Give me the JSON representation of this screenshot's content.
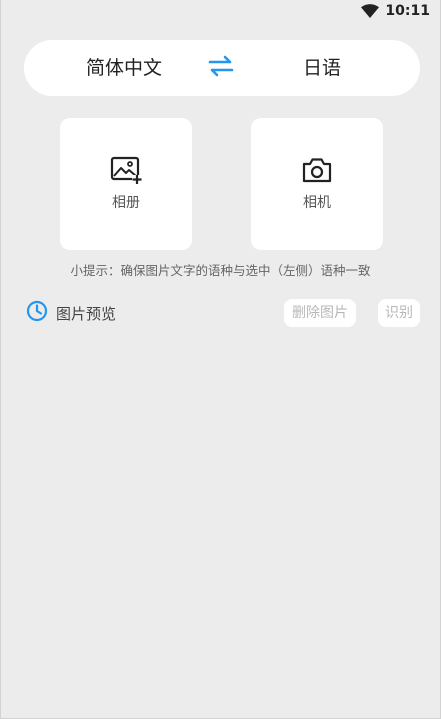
{
  "status_bar": {
    "time": "10:11",
    "wifi_icon": "wifi-icon"
  },
  "language_bar": {
    "source": "简体中文",
    "target": "日语",
    "swap_icon": "swap-icon",
    "accent": "#2196f3"
  },
  "cards": {
    "album_label": "相册",
    "album_icon": "image-add-icon",
    "camera_label": "相机",
    "camera_icon": "camera-icon"
  },
  "tip": "小提示：确保图片文字的语种与选中（左侧）语种一致",
  "preview": {
    "title": "图片预览",
    "clock_icon": "clock-icon",
    "delete_label": "删除图片",
    "recognize_label": "识别"
  }
}
